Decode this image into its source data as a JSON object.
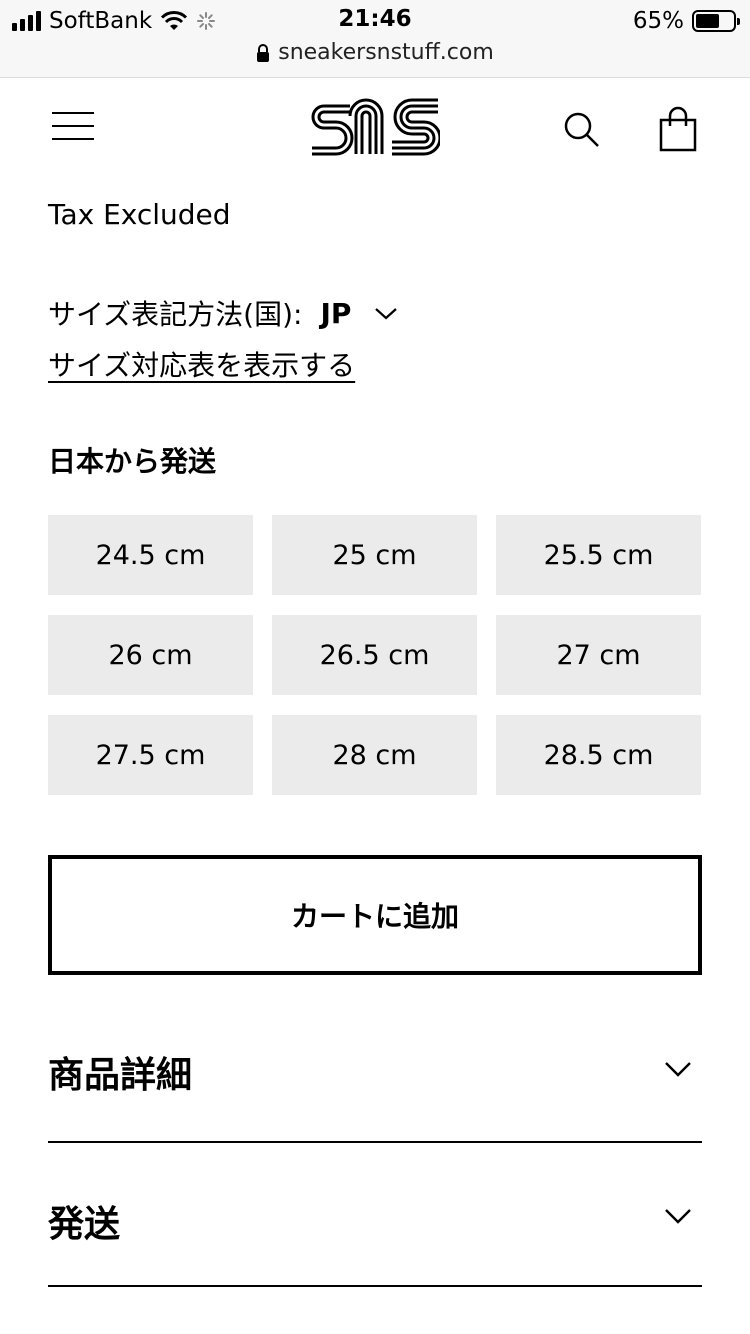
{
  "status_bar": {
    "carrier": "SoftBank",
    "time": "21:46",
    "battery": "65%",
    "battery_level": 0.65,
    "url": "sneakersnstuff.com"
  },
  "header": {
    "logo_icon": "sns-logo",
    "menu_icon": "hamburger-menu-icon",
    "search_icon": "search-icon",
    "cart_icon": "shopping-bag-icon"
  },
  "product": {
    "tax_note": "Tax Excluded",
    "size_system_label": "サイズ表記方法(国):",
    "size_system_value": "JP",
    "size_chart_link": "サイズ対応表を表示する",
    "ship_from": "日本から発送",
    "sizes": [
      "24.5 cm",
      "25 cm",
      "25.5 cm",
      "26 cm",
      "26.5 cm",
      "27 cm",
      "27.5 cm",
      "28 cm",
      "28.5 cm"
    ],
    "add_to_cart": "カートに追加"
  },
  "accordions": [
    {
      "title": "商品詳細"
    },
    {
      "title": "発送"
    }
  ],
  "colors": {
    "size_button_bg": "#ebebeb",
    "statusbar_bg": "#f7f7f7",
    "text": "#000000"
  }
}
